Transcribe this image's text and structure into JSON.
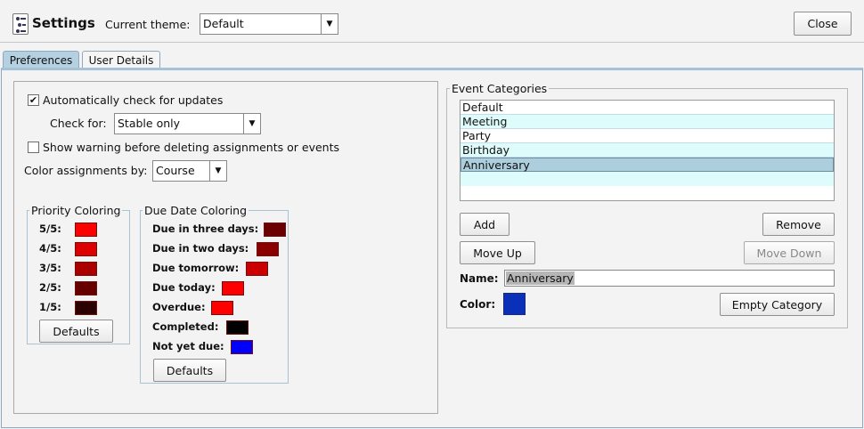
{
  "header": {
    "title": "Settings",
    "theme_label": "Current theme:",
    "theme_value": "Default",
    "close_label": "Close"
  },
  "tabs": [
    {
      "label": "Preferences",
      "active": true
    },
    {
      "label": "User Details",
      "active": false
    }
  ],
  "preferences": {
    "auto_update_label": "Automatically check for updates",
    "auto_update_checked": true,
    "check_for_label": "Check for:",
    "check_for_value": "Stable only",
    "warning_label": "Show warning before deleting assignments or events",
    "warning_checked": false,
    "color_by_label": "Color assignments by:",
    "color_by_value": "Course"
  },
  "priority_coloring": {
    "legend": "Priority Coloring",
    "items": [
      {
        "label": "5/5:",
        "color": "#ff0000"
      },
      {
        "label": "4/5:",
        "color": "#dd0000"
      },
      {
        "label": "3/5:",
        "color": "#aa0000"
      },
      {
        "label": "2/5:",
        "color": "#660000"
      },
      {
        "label": "1/5:",
        "color": "#2a0000"
      }
    ],
    "defaults_label": "Defaults"
  },
  "due_date_coloring": {
    "legend": "Due Date Coloring",
    "items": [
      {
        "label": "Due in three days:",
        "color": "#6a0000"
      },
      {
        "label": "Due in two days:",
        "color": "#8a0000"
      },
      {
        "label": "Due tomorrow:",
        "color": "#cc0000"
      },
      {
        "label": "Due today:",
        "color": "#ff0000"
      },
      {
        "label": "Overdue:",
        "color": "#ff0000"
      },
      {
        "label": "Completed:",
        "color": "#000000"
      },
      {
        "label": "Not yet due:",
        "color": "#0000ff"
      }
    ],
    "defaults_label": "Defaults"
  },
  "event_categories": {
    "legend": "Event Categories",
    "items": [
      "Default",
      "Meeting",
      "Party",
      "Birthday",
      "Anniversary"
    ],
    "selected": "Anniversary",
    "add_label": "Add",
    "remove_label": "Remove",
    "move_up_label": "Move Up",
    "move_down_label": "Move Down",
    "name_label": "Name:",
    "name_value": "Anniversary",
    "color_label": "Color:",
    "color_value": "#0a2fb8",
    "empty_category_label": "Empty Category"
  }
}
